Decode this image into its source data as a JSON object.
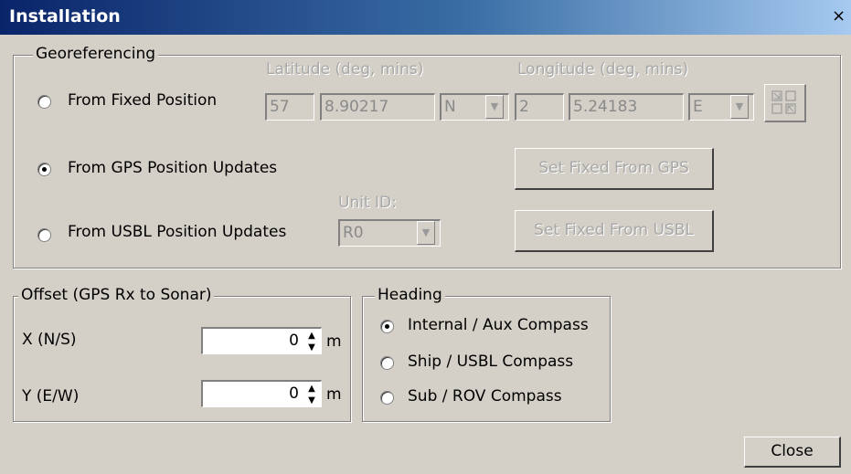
{
  "window": {
    "title": "Installation",
    "close_glyph": "×"
  },
  "georef": {
    "legend": "Georeferencing",
    "latitude_header": "Latitude (deg, mins)",
    "longitude_header": "Longitude (deg, mins)",
    "options": [
      {
        "label": "From Fixed Position",
        "selected": false
      },
      {
        "label": "From GPS Position Updates",
        "selected": true
      },
      {
        "label": "From USBL Position Updates",
        "selected": false
      }
    ],
    "lat_deg": "57",
    "lat_min": "8.90217",
    "lat_hemisphere": "N",
    "lon_deg": "2",
    "lon_min": "5.24183",
    "lon_hemisphere": "E",
    "unit_id_label": "Unit ID:",
    "unit_id_value": "R0",
    "set_fixed_gps_label": "Set Fixed From GPS",
    "set_fixed_usbl_label": "Set Fixed From USBL",
    "swap_icon": "swap-arrows-icon"
  },
  "offset": {
    "legend": "Offset (GPS Rx to Sonar)",
    "x_label": "X (N/S)",
    "x_value": "0",
    "y_label": "Y (E/W)",
    "y_value": "0",
    "unit": "m"
  },
  "heading": {
    "legend": "Heading",
    "options": [
      {
        "label": "Internal / Aux Compass",
        "selected": true
      },
      {
        "label": "Ship / USBL Compass",
        "selected": false
      },
      {
        "label": "Sub / ROV Compass",
        "selected": false
      }
    ]
  },
  "footer": {
    "close_label": "Close"
  }
}
